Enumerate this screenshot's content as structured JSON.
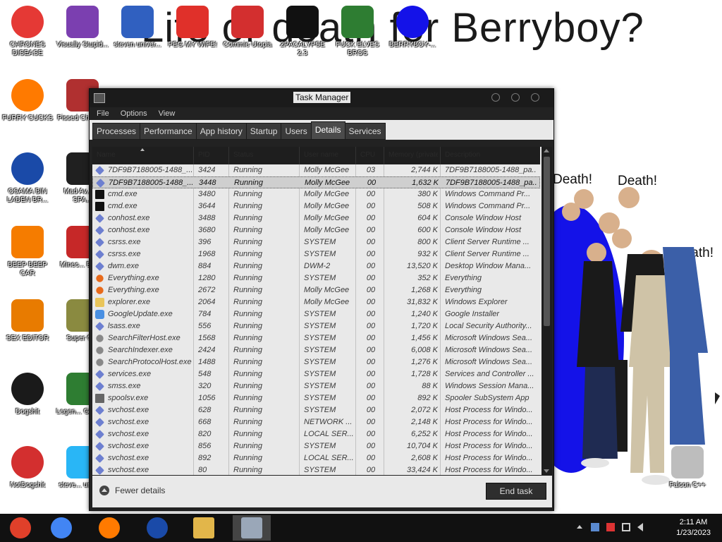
{
  "wallpaper": {
    "title": "Life or death for Berryboy?",
    "death_1": "Death!",
    "death_2": "Death!",
    "death_3": "Death!"
  },
  "desktop_icons": [
    {
      "label": "CHRONES DISEASE",
      "icon": "chrome-icon",
      "color": "#e53935"
    },
    {
      "label": "Visually Stupid...",
      "icon": "visual-studio-icon",
      "color": "#7b3fb0"
    },
    {
      "label": "steven univer...",
      "icon": "game-icon",
      "color": "#3060c0"
    },
    {
      "label": "PEG MY WIFE!",
      "icon": "p-logo-icon",
      "color": "#e0302a"
    },
    {
      "label": "Commie Utopia",
      "icon": "hammer-sickle-icon",
      "color": "#d32f2f"
    },
    {
      "label": "2PACALYPSE 2.3",
      "icon": "cmd-icon",
      "color": "#111111"
    },
    {
      "label": "FUCK ELVES BROS",
      "icon": "troll-face-icon",
      "color": "#2e7d32"
    },
    {
      "label": "BERRYBOY-...",
      "icon": "blue-dot-icon",
      "color": "#1412e8"
    },
    {
      "label": "FURRY CUCKS",
      "icon": "firefox-icon",
      "color": "#ff7a00"
    },
    {
      "label": "Pissed Chicke...",
      "icon": "angry-birds-icon",
      "color": "#b03030"
    },
    {
      "label": "OSAMA BIN LADEN BR...",
      "icon": "obama-logo-icon",
      "color": "#1a4aa8"
    },
    {
      "label": "Mad Av... IN SPA...",
      "icon": "angry-birds-space-icon",
      "color": "#202020"
    },
    {
      "label": "BEEP BEEP CAR",
      "icon": "vlc-icon",
      "color": "#f57c00"
    },
    {
      "label": "Minec... Bird...",
      "icon": "angry-bird-icon",
      "color": "#c62828"
    },
    {
      "label": "SEX EDITOR",
      "icon": "hxd-icon",
      "color": "#e87b00"
    },
    {
      "label": "Super G...",
      "icon": "pixel-game-icon",
      "color": "#8a8a40"
    },
    {
      "label": "Dogshit",
      "icon": "codeblocks-icon",
      "color": "#1a1a1a"
    },
    {
      "label": "Legen... GRYA...",
      "icon": "pixel-character-icon",
      "color": "#2e7d32"
    },
    {
      "label": "NotDogshit",
      "icon": "devcpp-icon",
      "color": "#d32f2f"
    },
    {
      "label": "steve... unive...",
      "icon": "diamond-icon",
      "color": "#29b6f6"
    },
    {
      "label": "Falcon C++",
      "icon": "recycle-bin-icon",
      "color": "#bdbdbd"
    }
  ],
  "task_manager": {
    "title": "Task Manager",
    "menu": [
      "File",
      "Options",
      "View"
    ],
    "tabs": [
      "Processes",
      "Performance",
      "App history",
      "Startup",
      "Users",
      "Details",
      "Services"
    ],
    "active_tab": "Details",
    "columns": [
      "Name",
      "PID",
      "Status",
      "User name",
      "CPU",
      "Memory (private working set)",
      "Description"
    ],
    "rows": [
      {
        "name": "7DF9B7188005-1488_...",
        "pid": "3424",
        "status": "Running",
        "user": "Molly McGee",
        "cpu": "03",
        "mem": "2,744 K",
        "desc": "7DF9B7188005-1488_pa...",
        "icon": "app-diamond-icon"
      },
      {
        "name": "7DF9B7188005-1488_...",
        "pid": "3448",
        "status": "Running",
        "user": "Molly McGee",
        "cpu": "00",
        "mem": "1,632 K",
        "desc": "7DF9B7188005-1488_pa...",
        "icon": "app-diamond-icon"
      },
      {
        "name": "cmd.exe",
        "pid": "3480",
        "status": "Running",
        "user": "Molly McGee",
        "cpu": "00",
        "mem": "380 K",
        "desc": "Windows Command Pr...",
        "icon": "cmd-icon"
      },
      {
        "name": "cmd.exe",
        "pid": "3644",
        "status": "Running",
        "user": "Molly McGee",
        "cpu": "00",
        "mem": "508 K",
        "desc": "Windows Command Pr...",
        "icon": "cmd-icon"
      },
      {
        "name": "conhost.exe",
        "pid": "3488",
        "status": "Running",
        "user": "Molly McGee",
        "cpu": "00",
        "mem": "604 K",
        "desc": "Console Window Host",
        "icon": "app-diamond-icon"
      },
      {
        "name": "conhost.exe",
        "pid": "3680",
        "status": "Running",
        "user": "Molly McGee",
        "cpu": "00",
        "mem": "600 K",
        "desc": "Console Window Host",
        "icon": "app-diamond-icon"
      },
      {
        "name": "csrss.exe",
        "pid": "396",
        "status": "Running",
        "user": "SYSTEM",
        "cpu": "00",
        "mem": "800 K",
        "desc": "Client Server Runtime ...",
        "icon": "app-diamond-icon"
      },
      {
        "name": "csrss.exe",
        "pid": "1968",
        "status": "Running",
        "user": "SYSTEM",
        "cpu": "00",
        "mem": "932 K",
        "desc": "Client Server Runtime ...",
        "icon": "app-diamond-icon"
      },
      {
        "name": "dwm.exe",
        "pid": "884",
        "status": "Running",
        "user": "DWM-2",
        "cpu": "00",
        "mem": "13,520 K",
        "desc": "Desktop Window Mana...",
        "icon": "app-diamond-icon"
      },
      {
        "name": "Everything.exe",
        "pid": "1280",
        "status": "Running",
        "user": "SYSTEM",
        "cpu": "00",
        "mem": "352 K",
        "desc": "Everything",
        "icon": "magnifier-icon"
      },
      {
        "name": "Everything.exe",
        "pid": "2672",
        "status": "Running",
        "user": "Molly McGee",
        "cpu": "00",
        "mem": "1,268 K",
        "desc": "Everything",
        "icon": "magnifier-icon"
      },
      {
        "name": "explorer.exe",
        "pid": "2064",
        "status": "Running",
        "user": "Molly McGee",
        "cpu": "00",
        "mem": "31,832 K",
        "desc": "Windows Explorer",
        "icon": "folder-icon"
      },
      {
        "name": "GoogleUpdate.exe",
        "pid": "784",
        "status": "Running",
        "user": "SYSTEM",
        "cpu": "00",
        "mem": "1,240 K",
        "desc": "Google Installer",
        "icon": "google-update-icon"
      },
      {
        "name": "lsass.exe",
        "pid": "556",
        "status": "Running",
        "user": "SYSTEM",
        "cpu": "00",
        "mem": "1,720 K",
        "desc": "Local Security Authority...",
        "icon": "app-diamond-icon"
      },
      {
        "name": "SearchFilterHost.exe",
        "pid": "1568",
        "status": "Running",
        "user": "SYSTEM",
        "cpu": "00",
        "mem": "1,456 K",
        "desc": "Microsoft Windows Sea...",
        "icon": "search-host-icon"
      },
      {
        "name": "SearchIndexer.exe",
        "pid": "2424",
        "status": "Running",
        "user": "SYSTEM",
        "cpu": "00",
        "mem": "6,008 K",
        "desc": "Microsoft Windows Sea...",
        "icon": "search-host-icon"
      },
      {
        "name": "SearchProtocolHost.exe",
        "pid": "1488",
        "status": "Running",
        "user": "SYSTEM",
        "cpu": "00",
        "mem": "1,276 K",
        "desc": "Microsoft Windows Sea...",
        "icon": "search-host-icon"
      },
      {
        "name": "services.exe",
        "pid": "548",
        "status": "Running",
        "user": "SYSTEM",
        "cpu": "00",
        "mem": "1,728 K",
        "desc": "Services and Controller ...",
        "icon": "app-diamond-icon"
      },
      {
        "name": "smss.exe",
        "pid": "320",
        "status": "Running",
        "user": "SYSTEM",
        "cpu": "00",
        "mem": "88 K",
        "desc": "Windows Session Mana...",
        "icon": "app-diamond-icon"
      },
      {
        "name": "spoolsv.exe",
        "pid": "1056",
        "status": "Running",
        "user": "SYSTEM",
        "cpu": "00",
        "mem": "892 K",
        "desc": "Spooler SubSystem App",
        "icon": "printer-icon"
      },
      {
        "name": "svchost.exe",
        "pid": "628",
        "status": "Running",
        "user": "SYSTEM",
        "cpu": "00",
        "mem": "2,072 K",
        "desc": "Host Process for Windo...",
        "icon": "app-diamond-icon"
      },
      {
        "name": "svchost.exe",
        "pid": "668",
        "status": "Running",
        "user": "NETWORK ...",
        "cpu": "00",
        "mem": "2,148 K",
        "desc": "Host Process for Windo...",
        "icon": "app-diamond-icon"
      },
      {
        "name": "svchost.exe",
        "pid": "820",
        "status": "Running",
        "user": "LOCAL SER...",
        "cpu": "00",
        "mem": "6,252 K",
        "desc": "Host Process for Windo...",
        "icon": "app-diamond-icon"
      },
      {
        "name": "svchost.exe",
        "pid": "856",
        "status": "Running",
        "user": "SYSTEM",
        "cpu": "00",
        "mem": "10,704 K",
        "desc": "Host Process for Windo...",
        "icon": "app-diamond-icon"
      },
      {
        "name": "svchost.exe",
        "pid": "892",
        "status": "Running",
        "user": "LOCAL SER...",
        "cpu": "00",
        "mem": "2,608 K",
        "desc": "Host Process for Windo...",
        "icon": "app-diamond-icon"
      },
      {
        "name": "svchost.exe",
        "pid": "80",
        "status": "Running",
        "user": "SYSTEM",
        "cpu": "00",
        "mem": "33,424 K",
        "desc": "Host Process for Windo...",
        "icon": "app-diamond-icon"
      }
    ],
    "selected_row": 1,
    "fewer_details": "Fewer details",
    "end_task": "End task"
  },
  "taskbar": {
    "apps": [
      {
        "icon": "chrome-classic-icon"
      },
      {
        "icon": "chrome-icon"
      },
      {
        "icon": "firefox-icon"
      },
      {
        "icon": "obama-logo-icon"
      },
      {
        "icon": "file-explorer-icon"
      },
      {
        "icon": "task-manager-icon"
      }
    ],
    "active_app": 5,
    "time": "2:11 AM",
    "date": "1/23/2023"
  }
}
